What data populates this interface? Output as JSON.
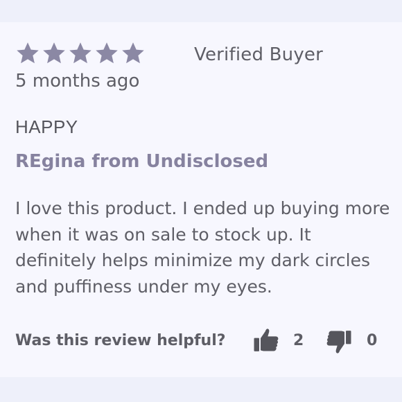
{
  "review": {
    "rating": 5,
    "rating_max": 5,
    "badge": "Verified Buyer",
    "date": "5 months ago",
    "title": "HAPPY",
    "author": "REgina from Undisclosed",
    "body": "I love this product. I ended up buying more when it was on sale to stock up. It definitely helps minimize my dark circles and puffiness under my eyes."
  },
  "helpful": {
    "question": "Was this review helpful?",
    "up_count": "2",
    "down_count": "0",
    "up_icon": "thumbs-up-icon",
    "down_icon": "thumbs-down-icon"
  },
  "colors": {
    "star": "#8b88a4",
    "author": "#86829f",
    "text": "#5e5e66",
    "card_background": "#f7f7fe",
    "page_background": "#eef0fa"
  }
}
